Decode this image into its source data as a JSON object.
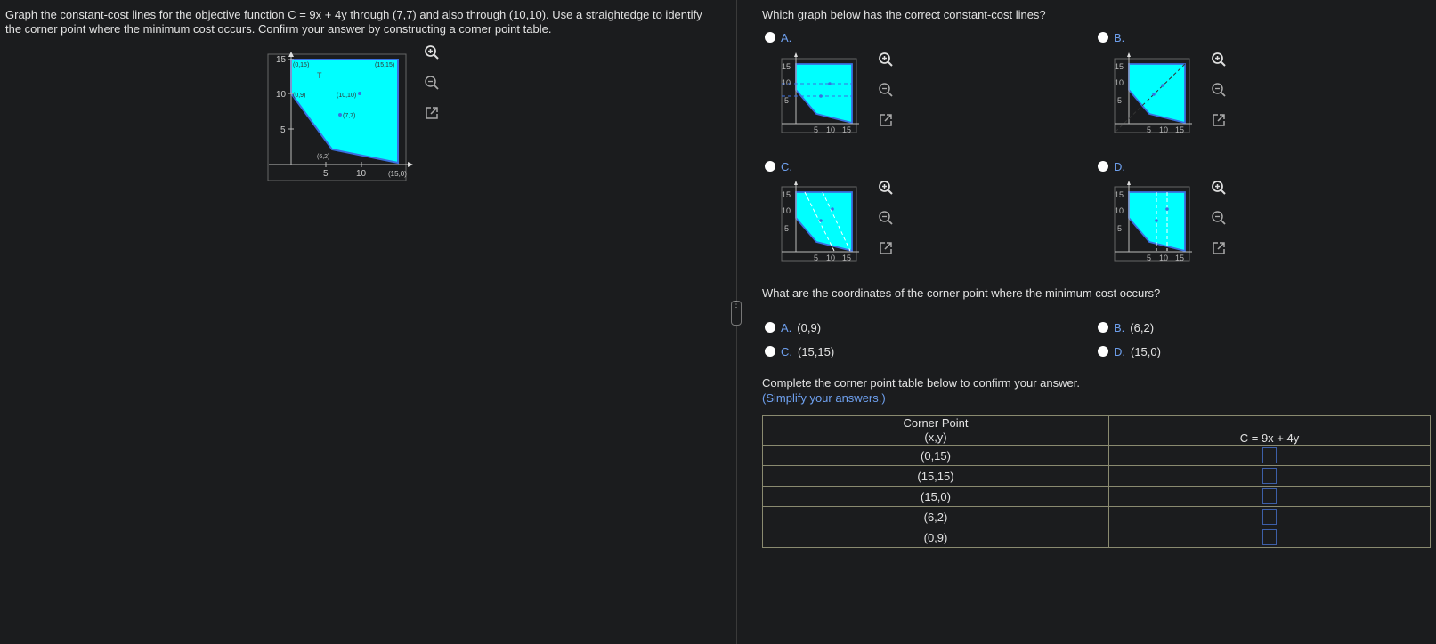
{
  "problem": {
    "line1": "Graph the constant-cost lines for the objective function C = 9x + 4y through  (7,7) and also through (10,10). Use a straightedge to identify",
    "line2": "the corner point where the minimum cost occurs. Confirm your answer by constructing a corner point table."
  },
  "main_graph": {
    "y_ticks": [
      "15",
      "10",
      "5"
    ],
    "x_ticks": [
      "5",
      "10"
    ],
    "point_labels": [
      "(0,15)",
      "(15,15)",
      "(0,9)",
      "(10,10)",
      "(7,7)",
      "(6,2)",
      "(15,0)"
    ],
    "t_label": "T",
    "fill_color": "#00ffff",
    "stroke_color": "#3b6fe0"
  },
  "q1": {
    "question": "Which graph below has the correct constant-cost lines?",
    "options": [
      {
        "letter": "A."
      },
      {
        "letter": "B."
      },
      {
        "letter": "C."
      },
      {
        "letter": "D."
      }
    ],
    "mini_y_ticks": [
      "15",
      "10",
      "5"
    ],
    "mini_x_ticks": [
      "5",
      "10",
      "15"
    ]
  },
  "q2": {
    "question": "What are the coordinates of the corner point where the minimum cost occurs?",
    "options": [
      {
        "letter": "A.",
        "value": "(0,9)"
      },
      {
        "letter": "B.",
        "value": "(6,2)"
      },
      {
        "letter": "C.",
        "value": "(15,15)"
      },
      {
        "letter": "D.",
        "value": "(15,0)"
      }
    ]
  },
  "table": {
    "instruction": "Complete the corner point table below to confirm your answer.",
    "hint": "(Simplify your answers.)",
    "header_col1_line1": "Corner Point",
    "header_col1_line2": "(x,y)",
    "header_col2": "C = 9x + 4y",
    "rows": [
      "(0,15)",
      "(15,15)",
      "(15,0)",
      "(6,2)",
      "(0,9)"
    ]
  },
  "icons": {
    "zoom_in": "zoom-in-icon",
    "zoom_out": "zoom-out-icon",
    "popout": "popout-icon"
  }
}
